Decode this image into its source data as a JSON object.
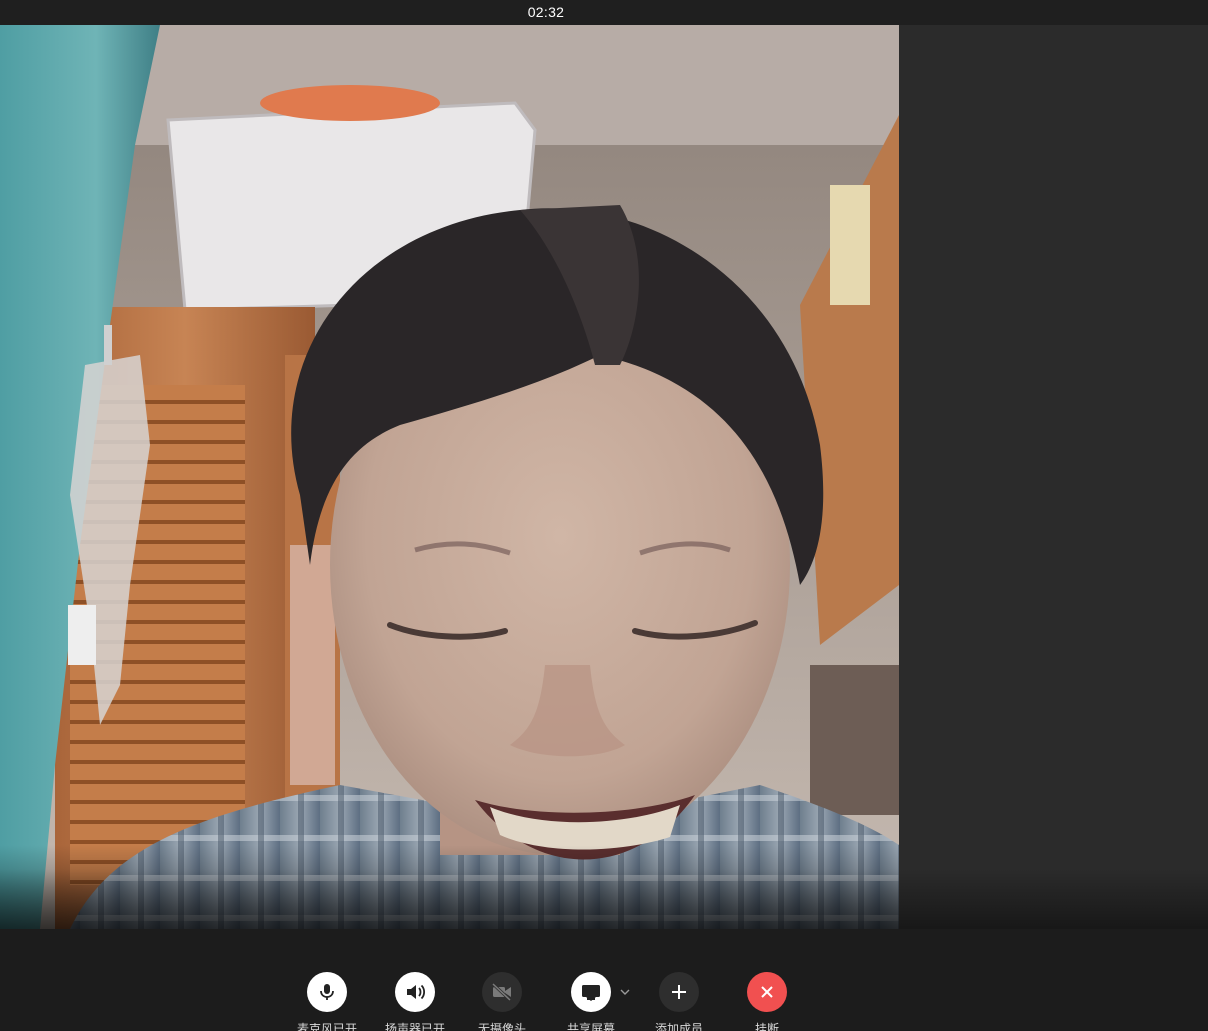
{
  "call": {
    "timer": "02:32"
  },
  "video": {
    "description_icon": "participant-video"
  },
  "controls": {
    "mic": {
      "label": "麦克风已开",
      "icon": "microphone-icon"
    },
    "speaker": {
      "label": "扬声器已开",
      "icon": "speaker-icon"
    },
    "camera": {
      "label": "无摄像头",
      "icon": "camera-off-icon"
    },
    "share": {
      "label": "共享屏幕",
      "icon": "screen-share-icon"
    },
    "add": {
      "label": "添加成员",
      "icon": "plus-icon"
    },
    "hangup": {
      "label": "挂断",
      "icon": "close-icon"
    }
  },
  "colors": {
    "hangup": "#f15050",
    "button": "#ffffff",
    "toolbar": "#1c1c1c"
  }
}
